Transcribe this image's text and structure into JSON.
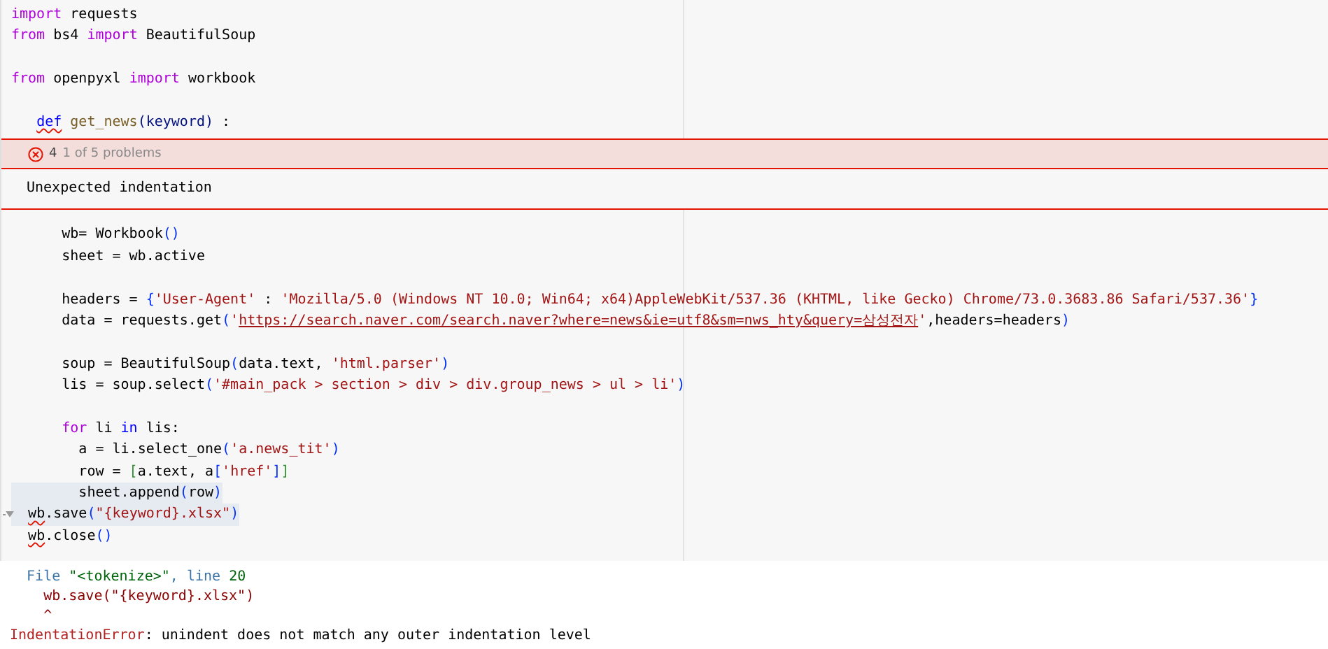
{
  "editor": {
    "lines_before": [
      {
        "kind": "code",
        "tokens": [
          {
            "text": "import",
            "kind": "keyword"
          },
          {
            "text": " requests",
            "kind": "plain"
          }
        ]
      },
      {
        "kind": "code",
        "tokens": [
          {
            "text": "from",
            "kind": "keyword"
          },
          {
            "text": " bs4 ",
            "kind": "plain"
          },
          {
            "text": "import",
            "kind": "keyword"
          },
          {
            "text": " BeautifulSoup",
            "kind": "plain"
          }
        ]
      },
      {
        "kind": "blank"
      },
      {
        "kind": "code",
        "tokens": [
          {
            "text": "from",
            "kind": "keyword"
          },
          {
            "text": " openpyxl ",
            "kind": "plain"
          },
          {
            "text": "import",
            "kind": "keyword"
          },
          {
            "text": " workbook",
            "kind": "plain"
          }
        ]
      },
      {
        "kind": "blank"
      },
      {
        "kind": "code",
        "tokens": [
          {
            "text": "   def",
            "kind": "squiggle-def"
          },
          {
            "text": " get_news",
            "kind": "function"
          },
          {
            "text": "(keyword)",
            "kind": "param"
          },
          {
            "text": " :",
            "kind": "plain"
          }
        ]
      }
    ],
    "problem": {
      "count": "4",
      "summary": "1 of 5 problems",
      "message": "Unexpected indentation"
    },
    "lines_after": [
      {
        "kind": "code",
        "tokens": [
          {
            "text": "      wb= Workbook",
            "kind": "plain"
          },
          {
            "text": "()",
            "kind": "bracket"
          }
        ]
      },
      {
        "kind": "code",
        "tokens": [
          {
            "text": "      sheet = wb.active",
            "kind": "plain"
          }
        ]
      },
      {
        "kind": "blank"
      },
      {
        "kind": "code",
        "tokens": [
          {
            "text": "      headers = ",
            "kind": "plain"
          },
          {
            "text": "{",
            "kind": "bracket"
          },
          {
            "text": "'User-Agent'",
            "kind": "string"
          },
          {
            "text": " : ",
            "kind": "plain"
          },
          {
            "text": "'Mozilla/5.0 (Windows NT 10.0; Win64; x64)AppleWebKit/537.36 (KHTML, like Gecko) Chrome/73.0.3683.86 Safari/537.36'",
            "kind": "string"
          },
          {
            "text": "}",
            "kind": "bracket"
          }
        ]
      },
      {
        "kind": "code",
        "tokens": [
          {
            "text": "      data = requests.get",
            "kind": "plain"
          },
          {
            "text": "(",
            "kind": "bracket"
          },
          {
            "text": "'",
            "kind": "string"
          },
          {
            "text": "https://search.naver.com/search.naver?where=news&ie=utf8&sm=nws_hty&query=삼성전자",
            "kind": "url"
          },
          {
            "text": "'",
            "kind": "string"
          },
          {
            "text": ",headers=headers",
            "kind": "plain"
          },
          {
            "text": ")",
            "kind": "bracket"
          }
        ]
      },
      {
        "kind": "blank"
      },
      {
        "kind": "code",
        "tokens": [
          {
            "text": "      soup = BeautifulSoup",
            "kind": "plain"
          },
          {
            "text": "(",
            "kind": "bracket"
          },
          {
            "text": "data.text, ",
            "kind": "plain"
          },
          {
            "text": "'html.parser'",
            "kind": "string"
          },
          {
            "text": ")",
            "kind": "bracket"
          }
        ]
      },
      {
        "kind": "code",
        "tokens": [
          {
            "text": "      lis = soup.select",
            "kind": "plain"
          },
          {
            "text": "(",
            "kind": "bracket"
          },
          {
            "text": "'#main_pack > section > div > div.group_news > ul > li'",
            "kind": "string"
          },
          {
            "text": ")",
            "kind": "bracket"
          }
        ]
      },
      {
        "kind": "blank"
      },
      {
        "kind": "code",
        "tokens": [
          {
            "text": "      for",
            "kind": "keyword"
          },
          {
            "text": " li ",
            "kind": "plain"
          },
          {
            "text": "in",
            "kind": "keyword-blue"
          },
          {
            "text": " lis:",
            "kind": "plain"
          }
        ]
      },
      {
        "kind": "code",
        "tokens": [
          {
            "text": "        a = li.select_one",
            "kind": "plain"
          },
          {
            "text": "(",
            "kind": "bracket"
          },
          {
            "text": "'a.news_tit'",
            "kind": "string"
          },
          {
            "text": ")",
            "kind": "bracket"
          }
        ]
      },
      {
        "kind": "code",
        "tokens": [
          {
            "text": "        row = ",
            "kind": "plain"
          },
          {
            "text": "[",
            "kind": "bracket-green"
          },
          {
            "text": "a.text, a",
            "kind": "plain"
          },
          {
            "text": "[",
            "kind": "bracket"
          },
          {
            "text": "'href'",
            "kind": "string"
          },
          {
            "text": "]",
            "kind": "bracket"
          },
          {
            "text": "]",
            "kind": "bracket-green"
          }
        ]
      },
      {
        "kind": "code",
        "tokens": [
          {
            "text": "        sheet.append",
            "kind": "plain"
          },
          {
            "text": "(",
            "kind": "bracket"
          },
          {
            "text": "row",
            "kind": "plain"
          },
          {
            "text": ")",
            "kind": "bracket"
          }
        ],
        "highlighted": true
      },
      {
        "kind": "code",
        "tokens": [
          {
            "text": "  wb",
            "kind": "squiggle"
          },
          {
            "text": ".save",
            "kind": "plain"
          },
          {
            "text": "(",
            "kind": "bracket"
          },
          {
            "text": "\"{keyword}.xlsx\"",
            "kind": "string"
          },
          {
            "text": ")",
            "kind": "bracket"
          }
        ],
        "highlighted": true,
        "fold": true
      },
      {
        "kind": "code",
        "tokens": [
          {
            "text": "  wb",
            "kind": "squiggle"
          },
          {
            "text": ".close",
            "kind": "plain"
          },
          {
            "text": "()",
            "kind": "bracket"
          }
        ]
      }
    ]
  },
  "output": {
    "file_line": [
      {
        "text": "  File ",
        "kind": "label"
      },
      {
        "text": "\"<tokenize>\"",
        "kind": "value"
      },
      {
        "text": ", line ",
        "kind": "label"
      },
      {
        "text": "20",
        "kind": "value"
      }
    ],
    "code": "    wb.save(\"{keyword}.xlsx\")",
    "caret": "    ^",
    "error_name": "IndentationError",
    "error_message": ": unindent does not match any outer indentation level"
  }
}
